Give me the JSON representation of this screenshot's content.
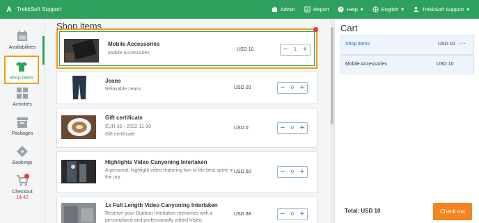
{
  "topbar": {
    "brand": "TrekkSoft Support",
    "admin": "Admin",
    "report": "Report",
    "help": "Help",
    "language": "English",
    "account": "TrekkSoft Support"
  },
  "sidebar": {
    "items": [
      {
        "label": "Availabilities",
        "icon": "calendar-icon"
      },
      {
        "label": "Shop items",
        "icon": "tshirt-icon"
      },
      {
        "label": "Activities",
        "icon": "grid-icon"
      },
      {
        "label": "Packages",
        "icon": "box-icon"
      },
      {
        "label": "Bookings",
        "icon": "ticket-icon"
      },
      {
        "label": "Checkout",
        "icon": "cart-icon"
      }
    ],
    "checkout_timer": "14:42"
  },
  "main": {
    "title": "Shop items",
    "items": [
      {
        "name": "Mobile Accessories",
        "desc": "Mobile Accessories",
        "price": "USD 10",
        "qty": "1"
      },
      {
        "name": "Jeans",
        "desc": "Relaxable Jeans",
        "price": "USD 20",
        "qty": "0"
      },
      {
        "name": "Gift certificate",
        "desc": "EUR 30 - 2022-11-30",
        "desc2": "Gift certificate",
        "price": "USD 0",
        "qty": "0"
      },
      {
        "name": "Highlights Video Canyoning Interlaken",
        "desc": "A personal, highlight video featuring two of the best spots in the trip.",
        "price": "USD 50",
        "qty": "0"
      },
      {
        "name": "1x Full Length Video Canyoning Interlaken",
        "desc": "Reserve your Outdoor Interlaken memories with a personalized and professionally edited Video.",
        "price": "USD 38",
        "qty": "0"
      }
    ]
  },
  "cart": {
    "title": "Cart",
    "header_label": "Shop items",
    "header_price": "USD 10",
    "more": "···",
    "line_label": "Mobile Accessories",
    "line_price": "USD 10",
    "total": "Total: USD 10",
    "checkout": "Check out"
  },
  "colors": {
    "brand_green": "#2fa15e",
    "highlight_orange": "#f39c12",
    "checkout_orange": "#f5841f",
    "link_blue": "#1a6cbf"
  }
}
